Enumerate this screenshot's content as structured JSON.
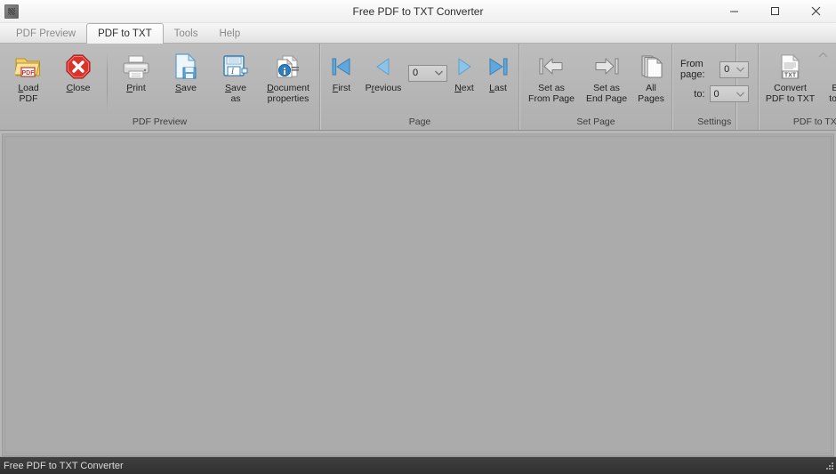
{
  "window": {
    "title": "Free PDF to TXT Converter",
    "app_icon": "app-icon",
    "minimize_label": "Minimize",
    "maximize_label": "Maximize",
    "close_label": "Close",
    "collapse_ribbon_label": "Collapse the Ribbon"
  },
  "tabs": [
    {
      "label": "PDF Preview",
      "active": false
    },
    {
      "label": "PDF to TXT",
      "active": true
    },
    {
      "label": "Tools",
      "active": false
    },
    {
      "label": "Help",
      "active": false
    }
  ],
  "ribbon": {
    "groups": [
      {
        "name": "PDF Preview",
        "label": "PDF Preview",
        "items": [
          {
            "id": "load-pdf",
            "icon": "folder-pdf-icon",
            "line1": "Load",
            "line2": "PDF",
            "accel": "L"
          },
          {
            "id": "close",
            "icon": "close-octagon-icon",
            "line1": "Close",
            "line2": "",
            "accel": "C"
          },
          {
            "id": "print",
            "icon": "printer-icon",
            "line1": "Print",
            "line2": "",
            "accel": "P"
          },
          {
            "id": "save",
            "icon": "save-page-icon",
            "line1": "Save",
            "line2": "",
            "accel": "S"
          },
          {
            "id": "save-as",
            "icon": "floppy-disk-icon",
            "line1": "Save",
            "line2": "as",
            "accel": "S"
          },
          {
            "id": "document-properties",
            "icon": "document-info-icon",
            "line1": "Document",
            "line2": "properties",
            "accel": "D"
          }
        ]
      },
      {
        "name": "Page",
        "label": "Page",
        "items": [
          {
            "id": "first",
            "icon": "skip-to-start-icon",
            "line1": "First",
            "line2": "",
            "accel": "F"
          },
          {
            "id": "previous",
            "icon": "previous-arrow-icon",
            "line1": "Previous",
            "line2": "",
            "accel": "r"
          },
          {
            "id": "next",
            "icon": "next-arrow-icon",
            "line1": "Next",
            "line2": "",
            "accel": "N"
          },
          {
            "id": "last",
            "icon": "skip-to-end-icon",
            "line1": "Last",
            "line2": "",
            "accel": "L"
          }
        ],
        "page_combo": {
          "value": "0",
          "icon": "chevron-down-icon"
        }
      },
      {
        "name": "Set Page",
        "label": "Set Page",
        "items": [
          {
            "id": "set-as-from-page",
            "icon": "arrow-to-left-bar-icon",
            "line1": "Set as",
            "line2": "From Page"
          },
          {
            "id": "set-as-end-page",
            "icon": "arrow-to-right-bar-icon",
            "line1": "Set as",
            "line2": "End Page"
          },
          {
            "id": "all-pages",
            "icon": "stacked-pages-icon",
            "line1": "All",
            "line2": "Pages"
          }
        ]
      },
      {
        "name": "Settings",
        "label": "Settings",
        "fields": [
          {
            "id": "from-page",
            "label": "From page:",
            "value": "0",
            "icon": "chevron-down-icon"
          },
          {
            "id": "to-page",
            "label": "to:",
            "value": "0",
            "icon": "chevron-down-icon"
          }
        ]
      },
      {
        "name": "PDF to TXT",
        "label": "PDF to TXT",
        "items": [
          {
            "id": "convert-pdf-to-txt",
            "icon": "txt-file-icon",
            "line1": "Convert",
            "line2": "PDF to TXT"
          },
          {
            "id": "export-to-word",
            "icon": "doc-file-icon",
            "line1": "Export",
            "line2": "to Word"
          }
        ]
      }
    ]
  },
  "statusbar": {
    "text": "Free PDF to TXT Converter",
    "grip_icon": "resize-grip-icon"
  },
  "colors": {
    "ribbon_bg": "#b6b6b6",
    "content_bg": "#ababab",
    "statusbar_bg": "#363636",
    "accent_blue": "#3f8fd0",
    "close_red": "#d02a28",
    "folder_yellow": "#f0c24b"
  }
}
